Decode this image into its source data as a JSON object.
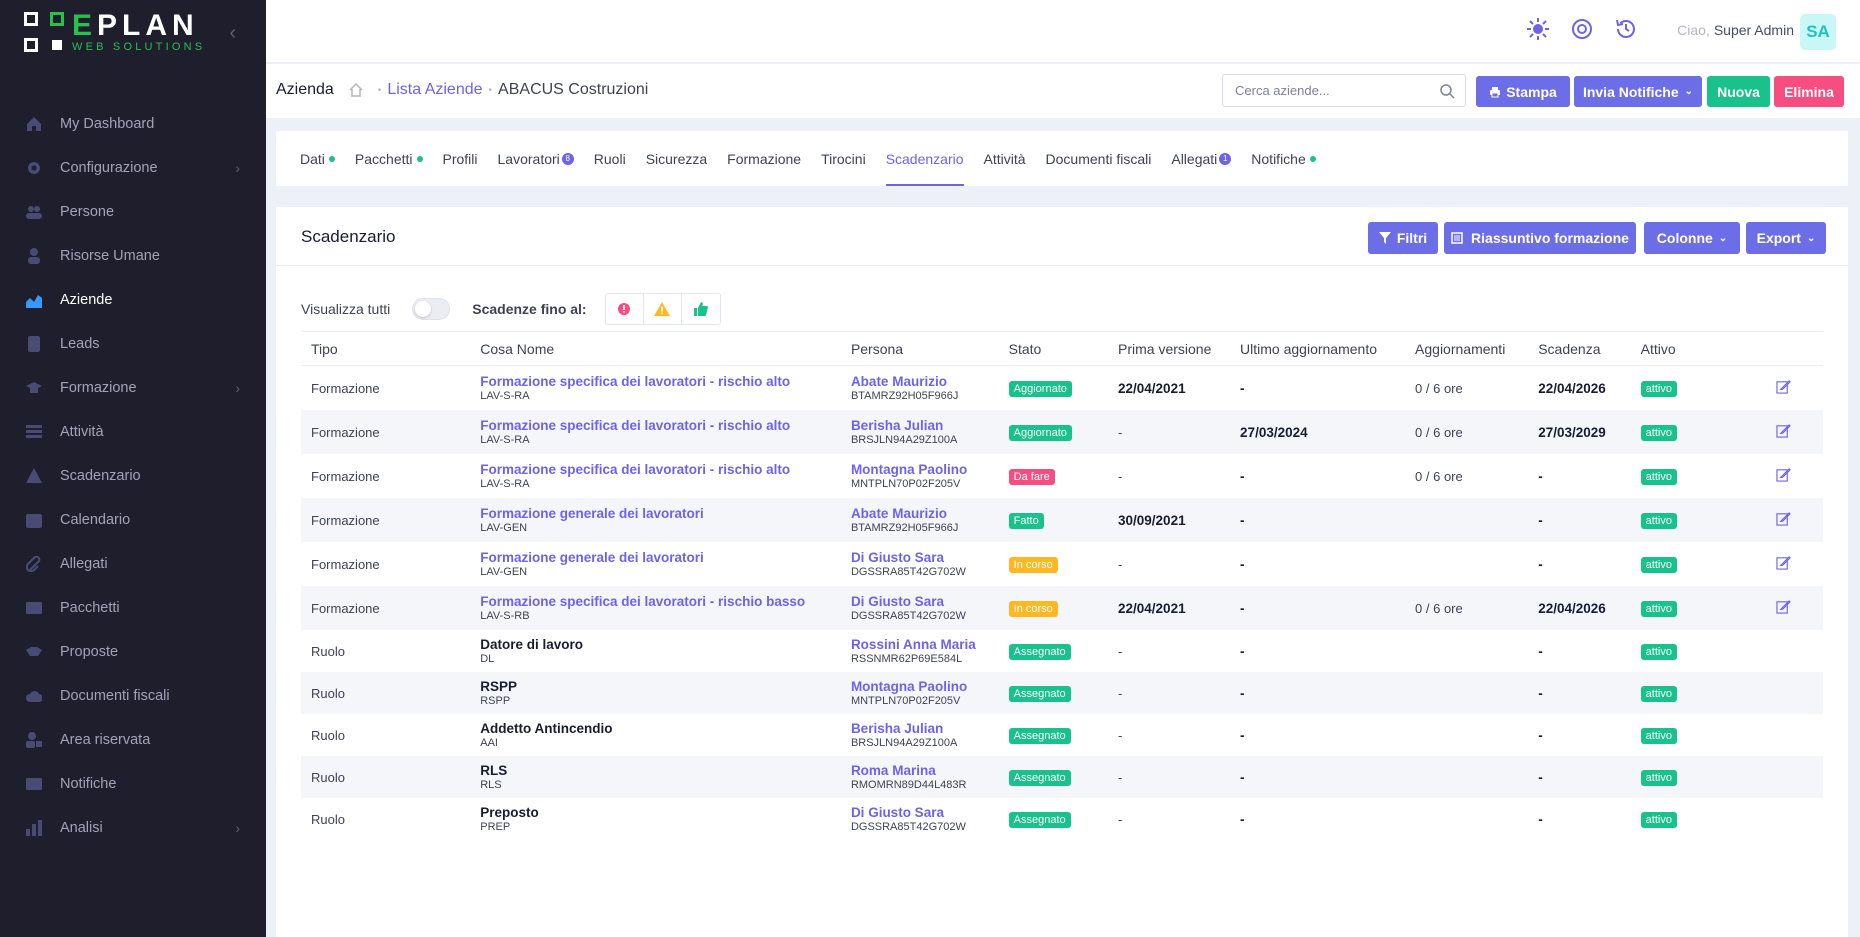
{
  "brand": {
    "main": "PLAN",
    "initial": "E",
    "sub": "WEB SOLUTIONS"
  },
  "sidebar": {
    "items": [
      {
        "label": "My Dashboard",
        "icon": "home-icon",
        "chev": false,
        "active": false
      },
      {
        "label": "Configurazione",
        "icon": "gear-icon",
        "chev": true,
        "active": false
      },
      {
        "label": "Persone",
        "icon": "users-icon",
        "chev": false,
        "active": false
      },
      {
        "label": "Risorse Umane",
        "icon": "user-icon",
        "chev": false,
        "active": false
      },
      {
        "label": "Aziende",
        "icon": "chart-area-icon",
        "chev": false,
        "active": true
      },
      {
        "label": "Leads",
        "icon": "contact-book-icon",
        "chev": false,
        "active": false
      },
      {
        "label": "Formazione",
        "icon": "graduation-cap-icon",
        "chev": true,
        "active": false
      },
      {
        "label": "Attività",
        "icon": "list-icon",
        "chev": false,
        "active": false
      },
      {
        "label": "Scadenzario",
        "icon": "warning-icon",
        "chev": false,
        "active": false
      },
      {
        "label": "Calendario",
        "icon": "calendar-icon",
        "chev": false,
        "active": false
      },
      {
        "label": "Allegati",
        "icon": "paperclip-icon",
        "chev": false,
        "active": false
      },
      {
        "label": "Pacchetti",
        "icon": "package-icon",
        "chev": false,
        "active": false
      },
      {
        "label": "Proposte",
        "icon": "handshake-icon",
        "chev": false,
        "active": false
      },
      {
        "label": "Documenti fiscali",
        "icon": "cloud-icon",
        "chev": false,
        "active": false
      },
      {
        "label": "Area riservata",
        "icon": "user-lock-icon",
        "chev": false,
        "active": false
      },
      {
        "label": "Notifiche",
        "icon": "envelope-icon",
        "chev": false,
        "active": false
      },
      {
        "label": "Analisi",
        "icon": "chart-icon",
        "chev": true,
        "active": false
      }
    ]
  },
  "header": {
    "greeting": "Ciao,",
    "user": "Super Admin",
    "initials": "SA"
  },
  "breadcrumb": {
    "title": "Azienda",
    "link": "Lista Aziende",
    "current": "ABACUS Costruzioni"
  },
  "search": {
    "placeholder": "Cerca aziende..."
  },
  "actions": {
    "print": "Stampa",
    "notify": "Invia Notifiche",
    "new": "Nuova",
    "delete": "Elimina"
  },
  "tabs": [
    {
      "label": "Dati",
      "dot": true,
      "count": ""
    },
    {
      "label": "Pacchetti",
      "dot": true,
      "count": ""
    },
    {
      "label": "Profili",
      "dot": false,
      "count": ""
    },
    {
      "label": "Lavoratori",
      "dot": false,
      "count": "8"
    },
    {
      "label": "Ruoli",
      "dot": false,
      "count": ""
    },
    {
      "label": "Sicurezza",
      "dot": false,
      "count": ""
    },
    {
      "label": "Formazione",
      "dot": false,
      "count": ""
    },
    {
      "label": "Tirocini",
      "dot": false,
      "count": ""
    },
    {
      "label": "Scadenzario",
      "dot": false,
      "count": "",
      "active": true
    },
    {
      "label": "Attività",
      "dot": false,
      "count": ""
    },
    {
      "label": "Documenti fiscali",
      "dot": false,
      "count": ""
    },
    {
      "label": "Allegati",
      "dot": false,
      "count": "1"
    },
    {
      "label": "Notifiche",
      "dot": true,
      "count": ""
    }
  ],
  "card": {
    "title": "Scadenzario",
    "filters": "Filtri",
    "riassuntivo": "Riassuntivo formazione",
    "colonne": "Colonne",
    "export": "Export",
    "show_all": "Visualizza tutti",
    "deadline_label": "Scadenze fino al:"
  },
  "table": {
    "headers": [
      "Tipo",
      "Cosa Nome",
      "Persona",
      "Stato",
      "Prima versione",
      "Ultimo aggiornamento",
      "Aggiornamenti",
      "Scadenza",
      "Attivo"
    ],
    "rows": [
      {
        "tipo": "Formazione",
        "name": "Formazione specifica dei lavoratori - rischio alto",
        "code": "LAV-S-RA",
        "link": true,
        "persona": "Abate Maurizio",
        "cf": "BTAMRZ92H05F966J",
        "stato": "Aggiornato",
        "stato_color": "green",
        "prima": "22/04/2021",
        "ultimo": "-",
        "agg": "0 / 6 ore",
        "scad": "22/04/2026",
        "attivo": "attivo",
        "edit": true
      },
      {
        "tipo": "Formazione",
        "name": "Formazione specifica dei lavoratori - rischio alto",
        "code": "LAV-S-RA",
        "link": true,
        "persona": "Berisha Julian",
        "cf": "BRSJLN94A29Z100A",
        "stato": "Aggiornato",
        "stato_color": "green",
        "prima": "-",
        "ultimo": "27/03/2024",
        "agg": "0 / 6 ore",
        "scad": "27/03/2029",
        "attivo": "attivo",
        "edit": true
      },
      {
        "tipo": "Formazione",
        "name": "Formazione specifica dei lavoratori - rischio alto",
        "code": "LAV-S-RA",
        "link": true,
        "persona": "Montagna Paolino",
        "cf": "MNTPLN70P02F205V",
        "stato": "Da fare",
        "stato_color": "red",
        "prima": "-",
        "ultimo": "-",
        "agg": "0 / 6 ore",
        "scad": "-",
        "attivo": "attivo",
        "edit": true
      },
      {
        "tipo": "Formazione",
        "name": "Formazione generale dei lavoratori",
        "code": "LAV-GEN",
        "link": true,
        "persona": "Abate Maurizio",
        "cf": "BTAMRZ92H05F966J",
        "stato": "Fatto",
        "stato_color": "green",
        "prima": "30/09/2021",
        "ultimo": "-",
        "agg": "",
        "scad": "-",
        "attivo": "attivo",
        "edit": true
      },
      {
        "tipo": "Formazione",
        "name": "Formazione generale dei lavoratori",
        "code": "LAV-GEN",
        "link": true,
        "persona": "Di Giusto Sara",
        "cf": "DGSSRA85T42G702W",
        "stato": "In corso",
        "stato_color": "yellow",
        "prima": "-",
        "ultimo": "-",
        "agg": "",
        "scad": "-",
        "attivo": "attivo",
        "edit": true
      },
      {
        "tipo": "Formazione",
        "name": "Formazione specifica dei lavoratori - rischio basso",
        "code": "LAV-S-RB",
        "link": true,
        "persona": "Di Giusto Sara",
        "cf": "DGSSRA85T42G702W",
        "stato": "In corso",
        "stato_color": "yellow",
        "prima": "22/04/2021",
        "ultimo": "-",
        "agg": "0 / 6 ore",
        "scad": "22/04/2026",
        "attivo": "attivo",
        "edit": true
      },
      {
        "tipo": "Ruolo",
        "name": "Datore di lavoro",
        "code": "DL",
        "link": false,
        "persona": "Rossini Anna Maria",
        "cf": "RSSNMR62P69E584L",
        "stato": "Assegnato",
        "stato_color": "green",
        "prima": "-",
        "ultimo": "-",
        "agg": "",
        "scad": "-",
        "attivo": "attivo",
        "edit": false
      },
      {
        "tipo": "Ruolo",
        "name": "RSPP",
        "code": "RSPP",
        "link": false,
        "persona": "Montagna Paolino",
        "cf": "MNTPLN70P02F205V",
        "stato": "Assegnato",
        "stato_color": "green",
        "prima": "-",
        "ultimo": "-",
        "agg": "",
        "scad": "-",
        "attivo": "attivo",
        "edit": false
      },
      {
        "tipo": "Ruolo",
        "name": "Addetto Antincendio",
        "code": "AAI",
        "link": false,
        "persona": "Berisha Julian",
        "cf": "BRSJLN94A29Z100A",
        "stato": "Assegnato",
        "stato_color": "green",
        "prima": "-",
        "ultimo": "-",
        "agg": "",
        "scad": "-",
        "attivo": "attivo",
        "edit": false
      },
      {
        "tipo": "Ruolo",
        "name": "RLS",
        "code": "RLS",
        "link": false,
        "persona": "Roma Marina",
        "cf": "RMOMRN89D44L483R",
        "stato": "Assegnato",
        "stato_color": "green",
        "prima": "-",
        "ultimo": "-",
        "agg": "",
        "scad": "-",
        "attivo": "attivo",
        "edit": false
      },
      {
        "tipo": "Ruolo",
        "name": "Preposto",
        "code": "PREP",
        "link": false,
        "persona": "Di Giusto Sara",
        "cf": "DGSSRA85T42G702W",
        "stato": "Assegnato",
        "stato_color": "green",
        "prima": "-",
        "ultimo": "-",
        "agg": "",
        "scad": "-",
        "attivo": "attivo",
        "edit": false
      }
    ]
  },
  "colors": {
    "accent": "#6b6ee6",
    "green": "#18c28a",
    "red": "#f64e80",
    "yellow": "#ffb822",
    "sidebar": "#1e1e2d"
  }
}
